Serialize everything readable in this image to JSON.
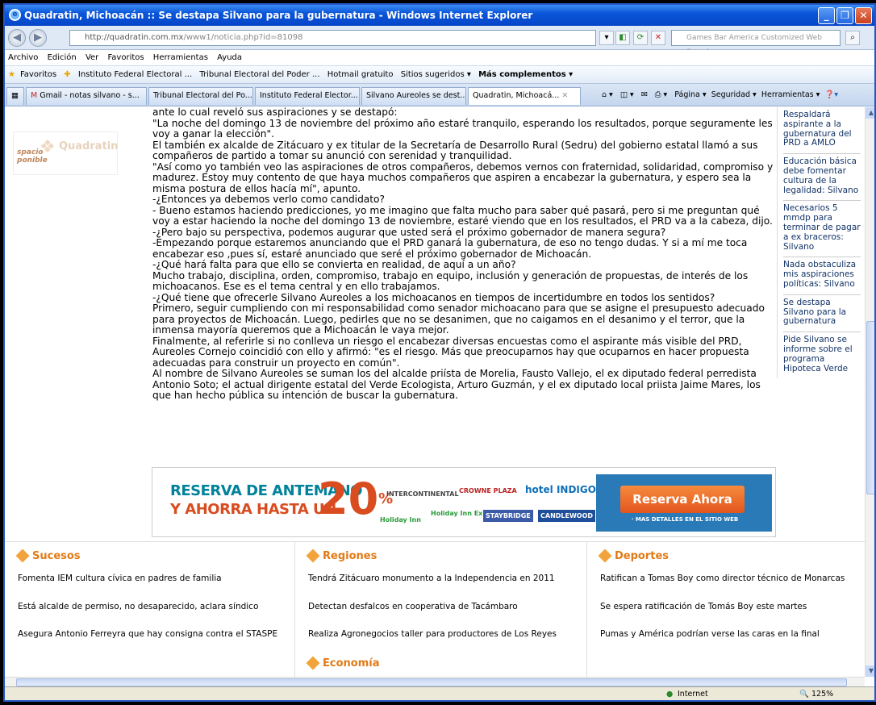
{
  "window": {
    "title": "Quadratin, Michoacán :: Se destapa Silvano para la gubernatura - Windows Internet Explorer"
  },
  "nav": {
    "url_host": "http://quadratin.com.mx",
    "url_path": "/www1/noticia.php?id=81098",
    "search_placeholder": "Games Bar America Customized Web Search"
  },
  "menu": [
    "Archivo",
    "Edición",
    "Ver",
    "Favoritos",
    "Herramientas",
    "Ayuda"
  ],
  "favorites": {
    "label": "Favoritos",
    "items": [
      "Instituto Federal Electoral ...",
      "Tribunal Electoral del Poder ...",
      "Hotmail gratuito",
      "Sitios sugeridos ▾",
      "Más complementos ▾"
    ]
  },
  "tabs": [
    "Gmail - notas silvano - s...",
    "Tribunal Electoral del Po...",
    "Instituto Federal Elector...",
    "Silvano Aureoles se dest...",
    "Quadratin, Michoacá..."
  ],
  "tools": {
    "pagina": "Página ▾",
    "seguridad": "Seguridad ▾",
    "herramientas": "Herramientas ▾"
  },
  "logo": {
    "text": "Quadratin",
    "spacio": "spacio\nponible"
  },
  "article": {
    "paragraphs": [
      "ante lo cual reveló sus aspiraciones y se destapó:",
      "\"La noche del domingo 13 de noviembre del próximo año estaré tranquilo, esperando los resultados, porque seguramente les voy a ganar la elección\".",
      "El también ex alcalde de Zitácuaro y ex titular de la Secretaría de Desarrollo Rural (Sedru) del gobierno estatal llamó a sus compañeros de partido a tomar su anunció con serenidad y tranquilidad.",
      "\"Así como yo también veo las aspiraciones de otros compañeros, debemos vernos con fraternidad, solidaridad, compromiso y madurez. Estoy muy contento de que haya muchos compañeros que aspiren a encabezar la gubernatura, y espero sea la misma postura de ellos hacía mí\", apunto.",
      "-¿Entonces ya debemos verlo como candidato?",
      "- Bueno estamos haciendo predicciones, yo me imagino que falta mucho para saber qué pasará, pero si me preguntan qué voy a estar haciendo la noche del domingo 13 de noviembre, estaré viendo que en los resultados, el PRD va a la cabeza, dijo.",
      "-¿Pero bajo su perspectiva, podemos augurar que usted será el próximo gobernador de manera segura?",
      "-Empezando porque estaremos anunciando que el PRD ganará la gubernatura, de eso no tengo dudas. Y si a mí me toca encabezar eso ,pues sí, estaré anunciado que seré el próximo gobernador de Michoacán.",
      "-¿Qué hará falta para que ello se convierta en realidad, de aquí a un año?",
      "Mucho trabajo, disciplina, orden, compromiso, trabajo en equipo, inclusión y generación de propuestas, de interés de los michoacanos. Ese es el tema central y en ello trabajamos.",
      "-¿Qué tiene que ofrecerle Silvano Aureoles a los michoacanos en tiempos de incertidumbre en todos los sentidos?",
      "Primero, seguir cumpliendo con mi responsabilidad como senador michoacano para que se asigne el presupuesto adecuado para proyectos de Michoacán. Luego, pedirles que no se desanimen, que no caigamos en el desanimo y el terror, que la inmensa mayoría queremos que a Michoacán le vaya mejor.",
      "Finalmente, al referirle si no conlleva un riesgo el encabezar diversas encuestas como el aspirante más visible del PRD, Aureoles Cornejo coincidió con ello y afirmó: \"es el riesgo. Más que preocuparnos hay que ocuparnos en hacer propuesta adecuadas para construir un proyecto en común\".",
      "Al nombre de Silvano Aureoles se suman los del alcalde priísta de Morelia, Fausto Vallejo, el ex diputado federal perredista Antonio Soto; el actual dirigente estatal del Verde Ecologista, Arturo Guzmán, y el ex diputado local priista Jaime Mares, los que han hecho pública su intención de buscar la gubernatura."
    ]
  },
  "sidebar": [
    "Respaldará aspirante a la gubernatura del PRD a AMLO",
    "Educación básica debe fomentar cultura de la legalidad: Silvano",
    "Necesarios 5 mmdp para terminar de pagar a ex braceros: Silvano",
    "Nada obstaculiza mis aspiraciones políticas: Silvano",
    "Se destapa Silvano para la gubernatura",
    "Pide Silvano se informe sobre el programa Hipoteca Verde"
  ],
  "ad": {
    "line1": "RESERVA DE ANTEMANO",
    "line2": "Y AHORRA HASTA UN",
    "percent": "20",
    "brands": [
      "INTERCONTINENTAL",
      "CROWNE PLAZA",
      "hotel INDIGO",
      "Holiday Inn",
      "Holiday Inn Express",
      "STAYBRIDGE",
      "CANDLEWOOD"
    ],
    "cta": "Reserva Ahora",
    "cta_sub": "· MAS DETALLES EN EL SITIO WEB"
  },
  "sections": [
    {
      "title": "Sucesos",
      "items": [
        "Fomenta IEM cultura cívica en padres de familia",
        "Está alcalde de permiso, no desaparecido, aclara síndico",
        "Asegura Antonio Ferreyra que hay consigna contra el STASPE"
      ]
    },
    {
      "title": "Regiones",
      "items": [
        "Tendrá Zitácuaro monumento a la Independencia en 2011",
        "Detectan desfalcos en cooperativa de Tacámbaro",
        "Realiza Agronegocios taller para productores de Los Reyes"
      ],
      "next": "Economía"
    },
    {
      "title": "Deportes",
      "items": [
        "Ratifican a Tomas Boy como director técnico de Monarcas",
        "Se espera ratificación de Tomás Boy este martes",
        "Pumas y América podrían verse las caras en la final"
      ]
    }
  ],
  "status": {
    "zone": "Internet",
    "zoom": "125%"
  }
}
